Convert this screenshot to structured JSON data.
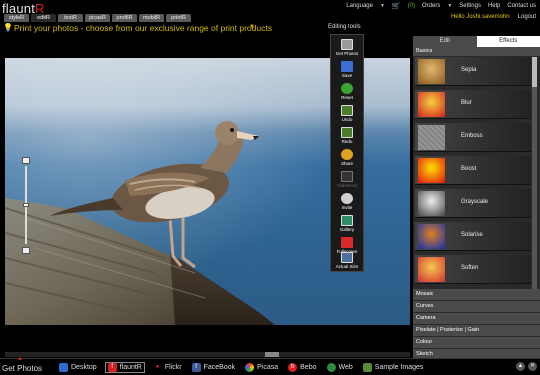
{
  "app": {
    "logo_main": "flaunt",
    "logo_accent": "R"
  },
  "topnav": {
    "language": "Language",
    "orders_count": "(0)",
    "orders": "Orders",
    "settings": "Settings",
    "help": "Help",
    "contact": "Contact us",
    "hello": "Hello Joshi.savemohn",
    "logout": "Logout"
  },
  "app_tabs": [
    "styleR",
    "editR",
    "textR",
    "picasR",
    "profilR",
    "mobilR",
    "printR"
  ],
  "banner": {
    "text": "Print your photos - choose from our exclusive range of print products"
  },
  "toolbar": {
    "title": "Editing tools",
    "tools": [
      "Get Photos",
      "Save",
      "Reset",
      "Undo",
      "Redo",
      "Share",
      "Slideshow",
      "Invite",
      "Gallery",
      "Fullscreen",
      "Actual Size"
    ]
  },
  "panel": {
    "tabs": [
      "Edit",
      "Effects"
    ],
    "basics": "Basics",
    "effects": [
      "Sepia",
      "Blur",
      "Emboss",
      "Boost",
      "Grayscale",
      "Solarise",
      "Soften"
    ],
    "categories": [
      "Mosaic",
      "Curves",
      "Camera",
      "Pixelate | Posterize | Gain",
      "Colour",
      "Sketch"
    ]
  },
  "bottom": {
    "get_photos": "Get Photos",
    "sources": [
      "Desktop",
      "flauntR",
      "Flickr",
      "FaceBook",
      "Picasa",
      "Bebo",
      "Web",
      "Sample Images"
    ]
  },
  "colors": {
    "accent_yellow": "#d2b800",
    "brand_red": "#d42020",
    "cart_green": "#5fbf2a"
  }
}
